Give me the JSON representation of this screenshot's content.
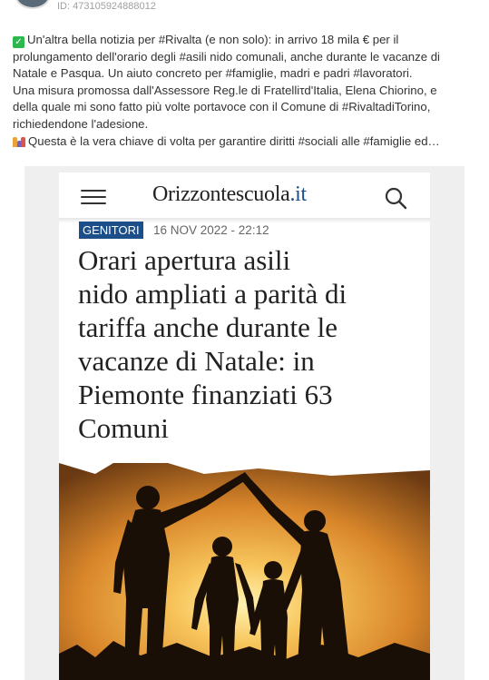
{
  "post": {
    "id_text": "ID: 473105924888012",
    "lines": [
      "Un'altra bella notizia per #Rivalta (e non solo): in arrivo 18 mila € per il",
      "prolungamento dell'orario degli #asili nido comunali, anche durante le vacanze di",
      "Natale e Pasqua. Un aiuto concreto per #famiglie, madri e padri #lavoratori.",
      "Una misura promossa dall'Assessore Reg.le di Fratelliτd'Italia, Elena Chiorino, e",
      "della quale mi sono fatto più volte portavoce con il Comune di #RivaltadiTorino,",
      "richiedendone l'adesione.",
      "Questa è la vera chiave di volta per garantire diritti #sociali alle #famiglie ed…"
    ]
  },
  "article": {
    "logo_main": "Orizzontescuola",
    "logo_tld": ".it",
    "category": "GENITORI",
    "date": "16 NOV 2022 - 22:12",
    "headline_lines": [
      "Orari apertura asili",
      "nido ampliati a parità di",
      "tariffa anche durante le",
      "vacanze di Natale: in",
      "Piemonte finanziati 63",
      "Comuni"
    ]
  },
  "colors": {
    "accent": "#1c4e8a",
    "check": "#2db84d"
  },
  "icons": [
    "check-mark-icon",
    "family-icon",
    "hamburger-menu-icon",
    "search-icon"
  ]
}
